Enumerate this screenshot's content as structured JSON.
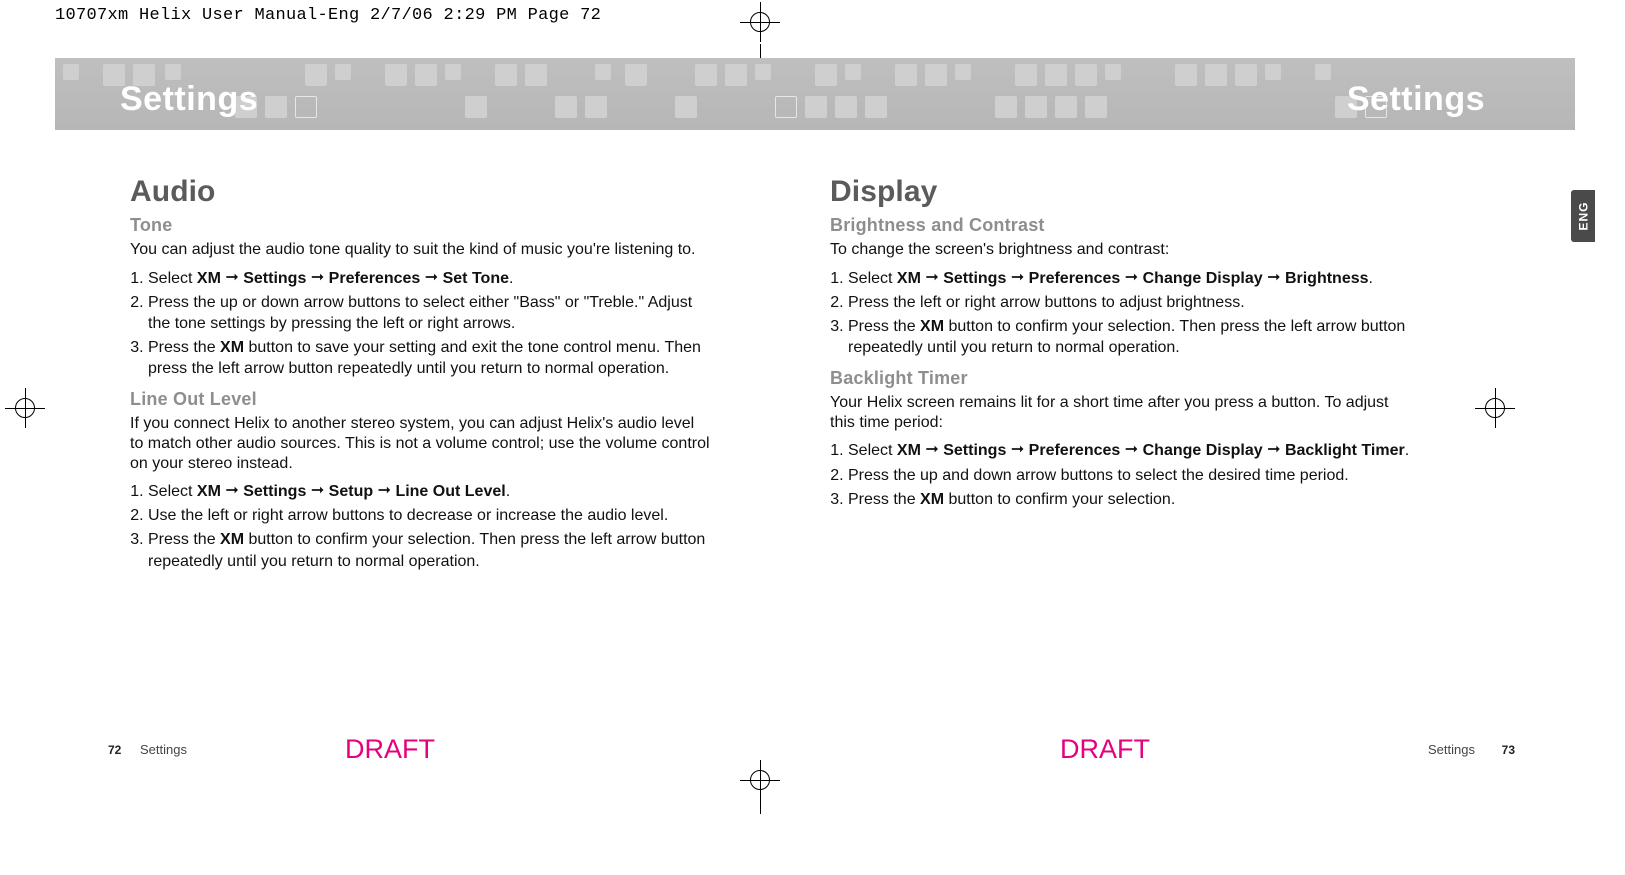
{
  "slug": "10707xm Helix User Manual-Eng  2/7/06  2:29 PM  Page 72",
  "banner": {
    "left_title": "Settings",
    "right_title": "Settings"
  },
  "eng_tab": "ENG",
  "left_page": {
    "h1": "Audio",
    "tone": {
      "heading": "Tone",
      "intro": "You can adjust the audio tone quality to suit the kind of music you're listening to.",
      "step1_pre": "Select ",
      "step1_b1": "XM",
      "step1_b2": "Settings",
      "step1_b3": "Preferences",
      "step1_b4": "Set Tone",
      "step2": "Press the up or down arrow buttons to select either \"Bass\" or \"Treble.\" Adjust the tone settings by pressing the left or right arrows.",
      "step3_pre": "Press the ",
      "step3_bold": "XM",
      "step3_post": " button to save your setting and exit the tone control menu. Then press the left arrow button repeatedly until you return to normal operation."
    },
    "line_out": {
      "heading": "Line Out Level",
      "intro": "If you connect Helix to another stereo system, you can adjust Helix's audio level to match other audio sources. This is not a volume control; use the volume control on your stereo instead.",
      "step1_pre": "Select ",
      "step1_b1": "XM",
      "step1_b2": "Settings",
      "step1_b3": "Setup",
      "step1_b4": "Line Out Level",
      "step2": "Use the left or right arrow buttons to decrease or increase the audio level.",
      "step3_pre": "Press the ",
      "step3_bold": "XM",
      "step3_post": " button to confirm your selection. Then press the left arrow button repeatedly until you return to normal operation."
    }
  },
  "right_page": {
    "h1": "Display",
    "brightness": {
      "heading": "Brightness and Contrast",
      "intro": "To change the screen's brightness and contrast:",
      "step1_pre": "Select ",
      "step1_b1": "XM",
      "step1_b2": "Settings",
      "step1_b3": "Preferences",
      "step1_b4": "Change Display",
      "step1_b5": "Brightness",
      "step2": "Press the left or right arrow buttons to adjust brightness.",
      "step3_pre": "Press the ",
      "step3_bold": "XM",
      "step3_post": " button to confirm your selection. Then press the left arrow button repeatedly until you return to normal operation."
    },
    "backlight": {
      "heading": "Backlight Timer",
      "intro": "Your Helix screen remains lit for a short time after you press a button. To adjust this time period:",
      "step1_pre": "Select ",
      "step1_b1": "XM",
      "step1_b2": "Settings",
      "step1_b3": "Preferences",
      "step1_b4": "Change Display",
      "step1_b5": "Backlight Timer",
      "step2": "Press the up and down arrow buttons to select the desired time period.",
      "step3_pre": "Press the ",
      "step3_bold": "XM",
      "step3_post": " button to confirm your selection."
    }
  },
  "footer": {
    "left_num": "72",
    "left_txt": "Settings",
    "right_txt": "Settings",
    "right_num": "73",
    "draft": "DRAFT"
  },
  "arrow": "➞"
}
